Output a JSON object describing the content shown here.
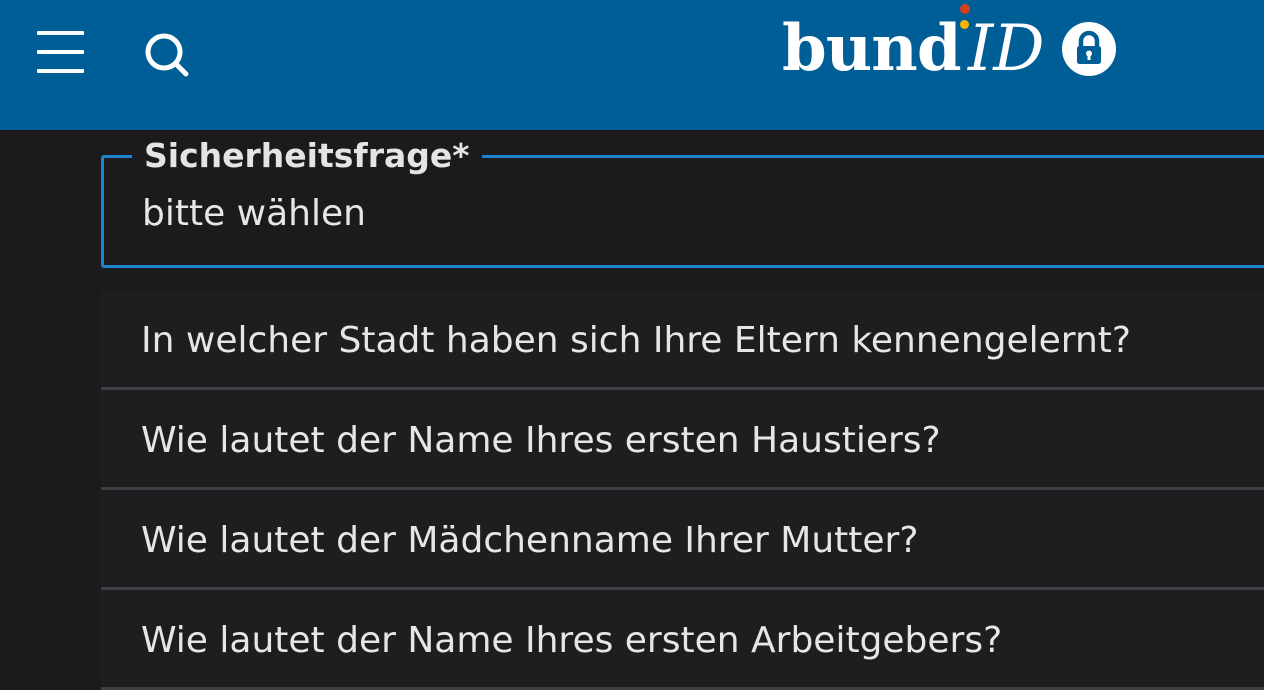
{
  "header": {
    "menu_icon": "hamburger-menu-icon",
    "search_icon": "search-icon",
    "logo": {
      "word_bund": "bund",
      "word_id": "ID",
      "lock_icon": "lock-icon"
    },
    "colors": {
      "background": "#005e97",
      "logo_dot_red": "#d6411b",
      "logo_dot_yellow": "#f5b400"
    }
  },
  "form": {
    "security_question": {
      "label": "Sicherheitsfrage*",
      "value": "bitte wählen",
      "focus_color": "#1f84cf"
    }
  },
  "dropdown": {
    "options": [
      {
        "label": "In welcher Stadt haben sich Ihre Eltern kennengelernt?"
      },
      {
        "label": "Wie lautet der Name Ihres ersten Haustiers?"
      },
      {
        "label": "Wie lautet der Mädchenname Ihrer Mutter?"
      },
      {
        "label": "Wie lautet der Name Ihres ersten Arbeitgebers?"
      }
    ]
  }
}
